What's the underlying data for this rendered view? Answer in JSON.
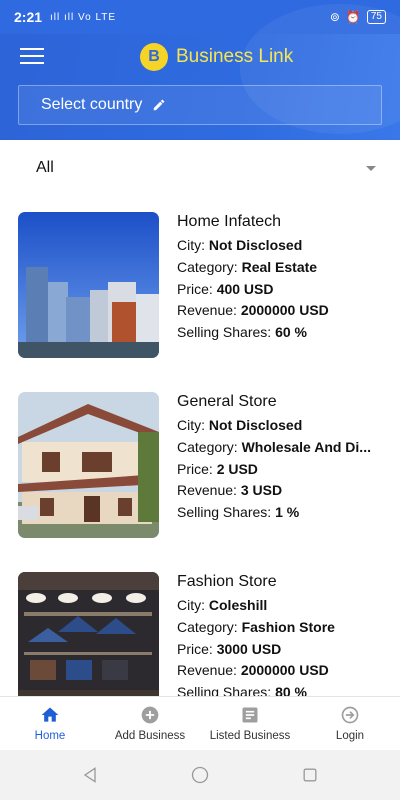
{
  "status_bar": {
    "time": "2:21",
    "signal": "ıll ıll Vo LTE",
    "battery": "75"
  },
  "header": {
    "brand_name": "Business Link",
    "logo_glyph": "B",
    "country_placeholder": "Select country"
  },
  "filter": {
    "selected": "All"
  },
  "listings": [
    {
      "title": "Home Infatech",
      "city_label": "City:",
      "city": "Not Disclosed",
      "category_label": "Category:",
      "category": "Real Estate",
      "price_label": "Price:",
      "price": "400 USD",
      "revenue_label": "Revenue:",
      "revenue": "2000000 USD",
      "shares_label": "Selling Shares:",
      "shares": "60 %"
    },
    {
      "title": "General Store",
      "city_label": "City:",
      "city": "Not Disclosed",
      "category_label": "Category:",
      "category": "Wholesale And Di...",
      "price_label": "Price:",
      "price": "2 USD",
      "revenue_label": "Revenue:",
      "revenue": "3 USD",
      "shares_label": "Selling Shares:",
      "shares": "1 %"
    },
    {
      "title": "Fashion Store",
      "city_label": "City:",
      "city": "Coleshill",
      "category_label": "Category:",
      "category": "Fashion Store",
      "price_label": "Price:",
      "price": "3000 USD",
      "revenue_label": "Revenue:",
      "revenue": "2000000 USD",
      "shares_label": "Selling Shares:",
      "shares": "80 %"
    }
  ],
  "bottom_nav": [
    {
      "label": "Home",
      "icon": "home-icon",
      "active": true
    },
    {
      "label": "Add Business",
      "icon": "add-circle-icon"
    },
    {
      "label": "Listed Business",
      "icon": "list-icon"
    },
    {
      "label": "Login",
      "icon": "login-icon"
    }
  ],
  "colors": {
    "primary": "#2f6ae0",
    "brand_yellow": "#f6e64b",
    "active_nav": "#1f5fd6"
  }
}
